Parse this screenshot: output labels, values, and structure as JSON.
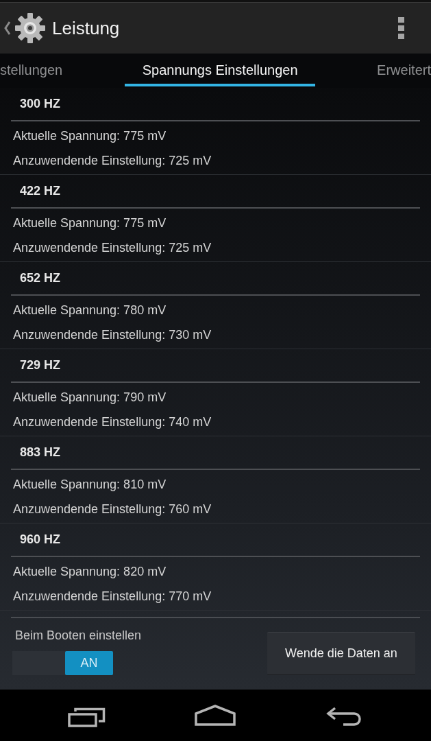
{
  "action_bar": {
    "title": "Leistung"
  },
  "tabs": [
    {
      "label": "stellungen",
      "selected": false
    },
    {
      "label": "Spannungs Einstellungen",
      "selected": true
    },
    {
      "label": "Erweitert",
      "selected": false
    }
  ],
  "frequencies": [
    {
      "header": "300 HZ",
      "current": "Aktuelle Spannung: 775 mV",
      "apply": "Anzuwendende Einstellung: 725 mV"
    },
    {
      "header": "422 HZ",
      "current": "Aktuelle Spannung: 775 mV",
      "apply": "Anzuwendende Einstellung: 725 mV"
    },
    {
      "header": "652 HZ",
      "current": "Aktuelle Spannung: 780 mV",
      "apply": "Anzuwendende Einstellung: 730 mV"
    },
    {
      "header": "729 HZ",
      "current": "Aktuelle Spannung: 790 mV",
      "apply": "Anzuwendende Einstellung: 740 mV"
    },
    {
      "header": "883 HZ",
      "current": "Aktuelle Spannung: 810 mV",
      "apply": "Anzuwendende Einstellung: 760 mV"
    },
    {
      "header": "960 HZ",
      "current": "Aktuelle Spannung: 820 mV",
      "apply": "Anzuwendende Einstellung: 770 mV"
    }
  ],
  "footer": {
    "boot_label": "Beim Booten einstellen",
    "boot_toggle": {
      "label": "AN",
      "on": true
    },
    "apply_button": "Wende die Daten an"
  }
}
